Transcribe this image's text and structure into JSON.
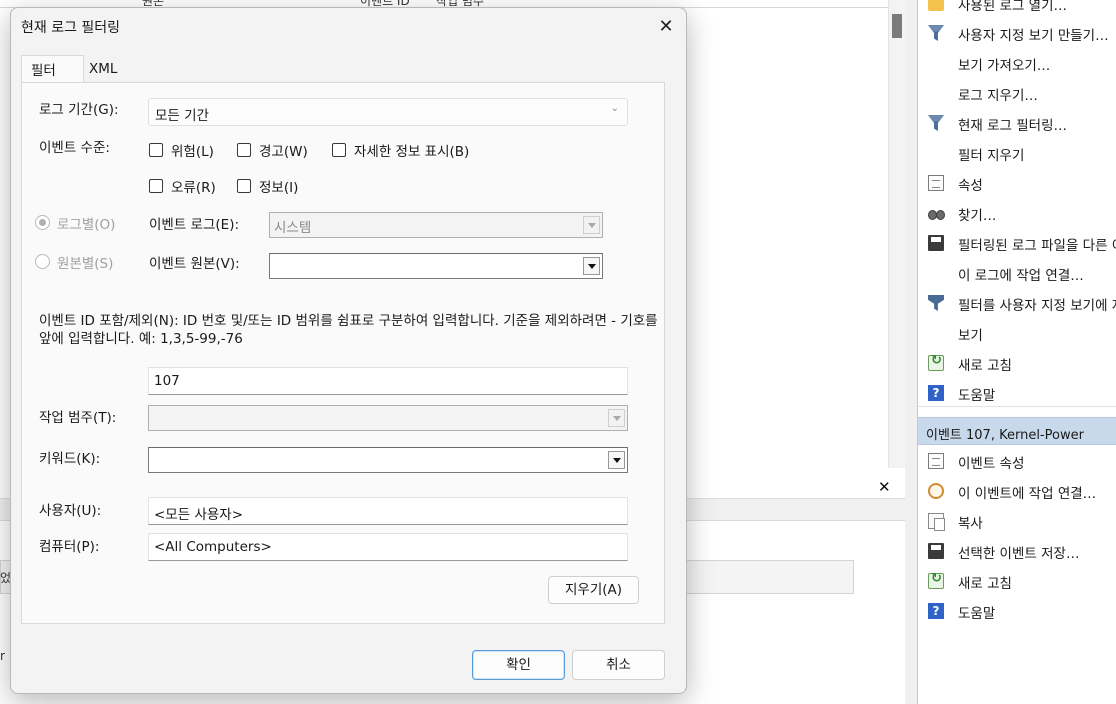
{
  "dialog": {
    "title": "현재 로그 필터링",
    "close": "✕",
    "tabs": {
      "filter": "필터",
      "xml": "XML"
    },
    "log_period": {
      "label": "로그 기간(G):",
      "value": "모든 기간"
    },
    "event_level": {
      "label": "이벤트 수준:",
      "options": [
        "위험(L)",
        "경고(W)",
        "자세한 정보 표시(B)",
        "오류(R)",
        "정보(I)"
      ]
    },
    "by_log": {
      "label": "로그별(O)",
      "field_label": "이벤트 로그(E):",
      "value": "시스템"
    },
    "by_source": {
      "label": "원본별(S)",
      "field_label": "이벤트 원본(V):",
      "value": ""
    },
    "id_description": "이벤트 ID 포함/제외(N): ID 번호 및/또는 ID 범위를 쉼표로 구분하여 입력합니다. 기준을 제외하려면 - 기호를 앞에 입력합니다. 예: 1,3,5-99,-76",
    "event_id_value": "107",
    "task_category": {
      "label": "작업 범주(T):",
      "value": ""
    },
    "keywords": {
      "label": "키워드(K):",
      "value": ""
    },
    "user": {
      "label": "사용자(U):",
      "value": "<모든 사용자>"
    },
    "computer": {
      "label": "컴퓨터(P):",
      "value": "<All Computers>"
    },
    "clear_button": "지우기(A)",
    "ok_button": "확인",
    "cancel_button": "취소"
  },
  "background": {
    "header_col1": "원본",
    "header_col2": "이벤트 ID",
    "header_col3": "작업 범주",
    "bottom_close": "✕",
    "left_frag1": "었",
    "left_frag2": "r"
  },
  "actions": {
    "items_top": [
      {
        "label": "사용된 로그 열기…",
        "icon": "folder-icon"
      },
      {
        "label": "사용자 지정 보기 만들기…",
        "icon": "funnel-icon"
      },
      {
        "label": "보기 가져오기…",
        "icon": ""
      },
      {
        "label": "로그 지우기…",
        "icon": ""
      },
      {
        "label": "현재 로그 필터링…",
        "icon": "funnel-icon"
      },
      {
        "label": "필터 지우기",
        "icon": ""
      },
      {
        "label": "속성",
        "icon": "properties-icon"
      },
      {
        "label": "찾기…",
        "icon": "binoculars-icon"
      },
      {
        "label": "필터링된 로그 파일을 다른 이름으로 저장…",
        "icon": "save-icon"
      },
      {
        "label": "이 로그에 작업 연결…",
        "icon": ""
      },
      {
        "label": "필터를 사용자 지정 보기에 저장…",
        "icon": "filter-view-icon"
      },
      {
        "label": "보기",
        "icon": ""
      },
      {
        "label": "새로 고침",
        "icon": "refresh-icon"
      },
      {
        "label": "도움말",
        "icon": "help-icon"
      }
    ],
    "section_title": "이벤트 107, Kernel-Power",
    "items_bottom": [
      {
        "label": "이벤트 속성",
        "icon": "properties-icon"
      },
      {
        "label": "이 이벤트에 작업 연결…",
        "icon": "task-icon"
      },
      {
        "label": "복사",
        "icon": "copy-icon"
      },
      {
        "label": "선택한 이벤트 저장…",
        "icon": "save-icon"
      },
      {
        "label": "새로 고침",
        "icon": "refresh-icon"
      },
      {
        "label": "도움말",
        "icon": "help-icon"
      }
    ]
  }
}
